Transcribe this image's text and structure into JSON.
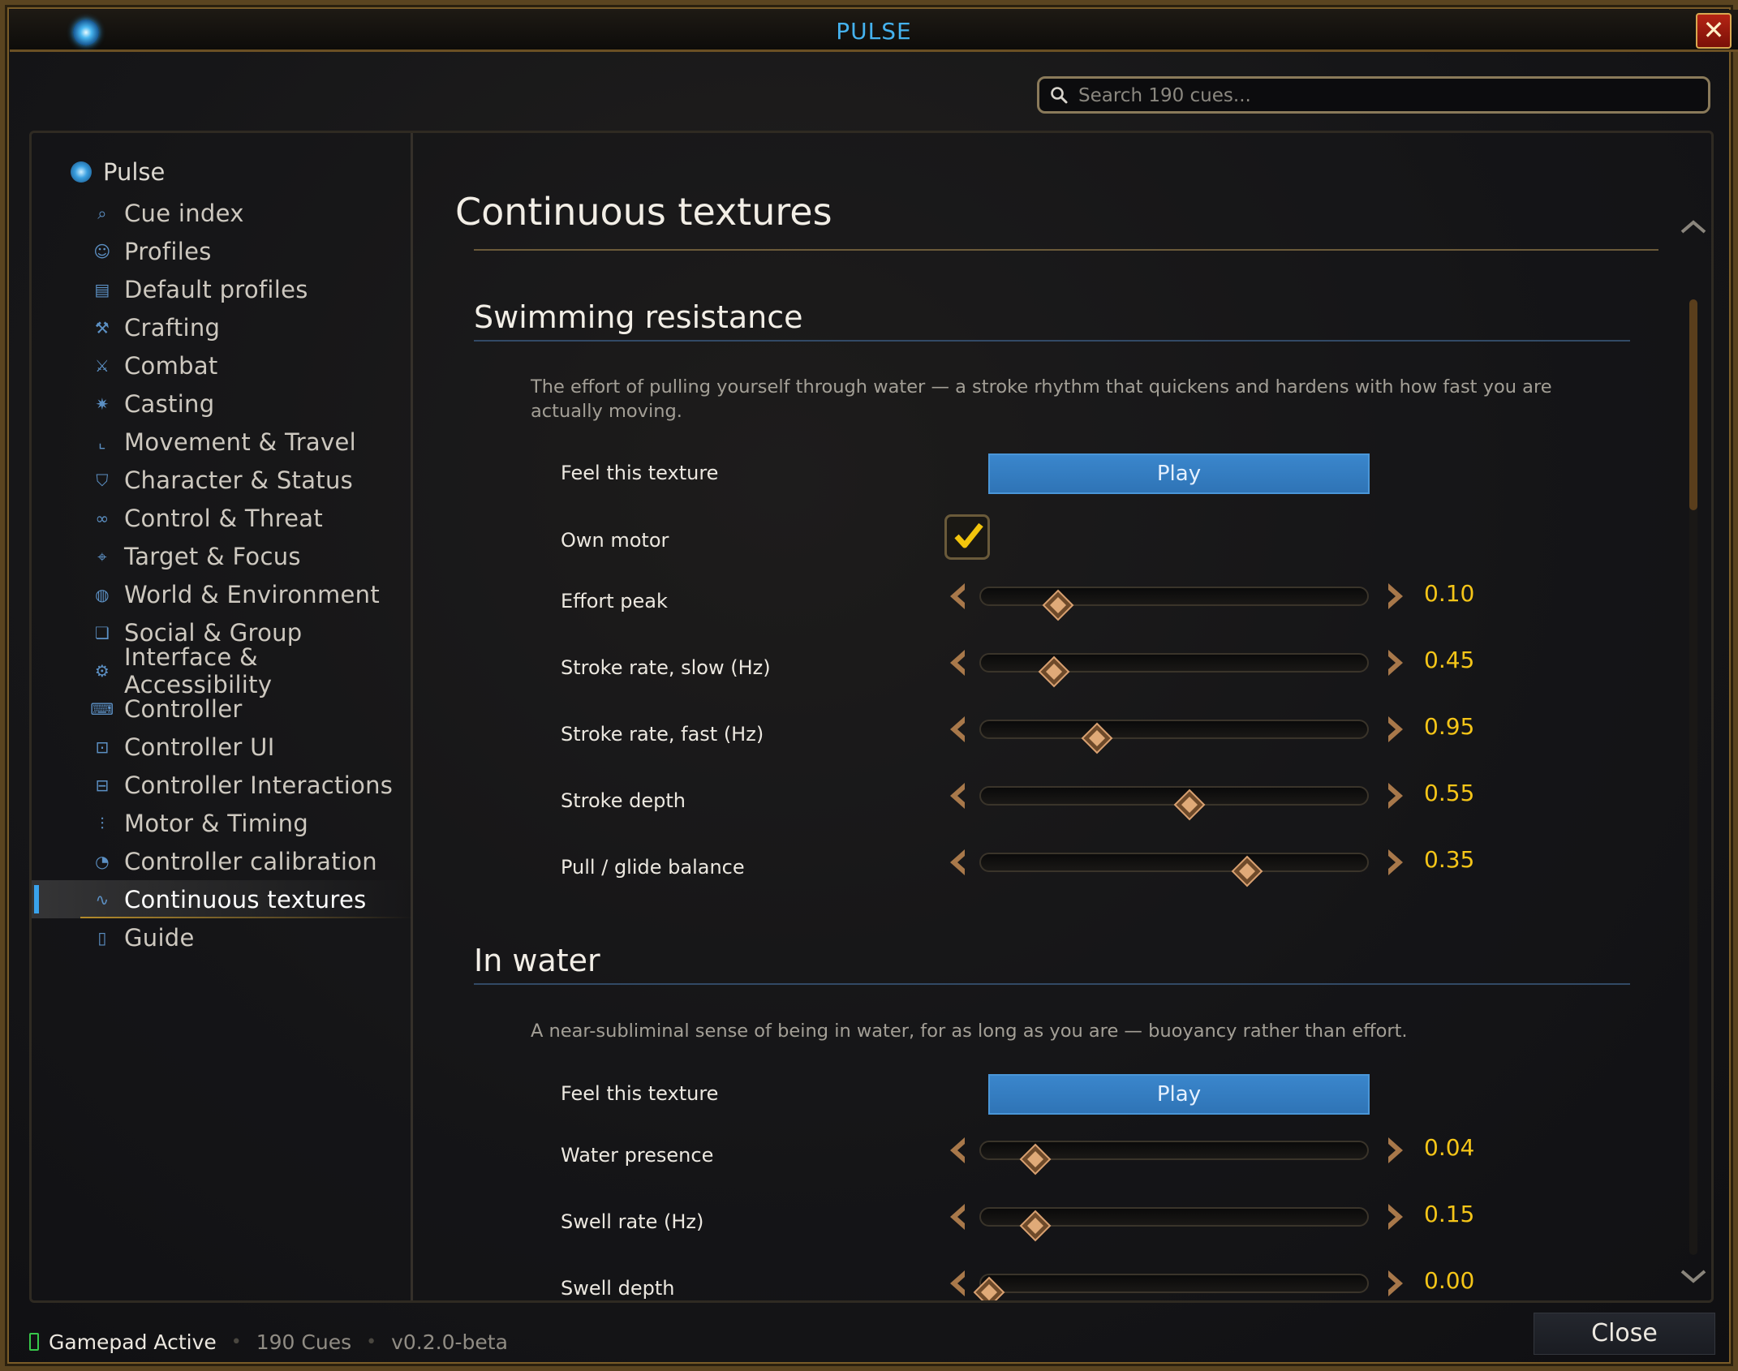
{
  "window": {
    "title": "PULSE",
    "close_glyph": "✕"
  },
  "search": {
    "placeholder": "Search 190 cues..."
  },
  "sidebar": {
    "root_label": "Pulse",
    "items": [
      {
        "label": "Cue index",
        "icon": "magnifier-icon",
        "glyph": "⌕"
      },
      {
        "label": "Profiles",
        "icon": "person-icon",
        "glyph": "☺"
      },
      {
        "label": "Default profiles",
        "icon": "document-icon",
        "glyph": "▤"
      },
      {
        "label": "Crafting",
        "icon": "anvil-icon",
        "glyph": "⚒"
      },
      {
        "label": "Combat",
        "icon": "crossed-swords-icon",
        "glyph": "⚔"
      },
      {
        "label": "Casting",
        "icon": "sparkle-icon",
        "glyph": "✷"
      },
      {
        "label": "Movement & Travel",
        "icon": "boot-icon",
        "glyph": "⌞"
      },
      {
        "label": "Character & Status",
        "icon": "shield-icon",
        "glyph": "⛉"
      },
      {
        "label": "Control & Threat",
        "icon": "chain-icon",
        "glyph": "∞"
      },
      {
        "label": "Target & Focus",
        "icon": "crosshair-icon",
        "glyph": "⌖"
      },
      {
        "label": "World & Environment",
        "icon": "globe-icon",
        "glyph": "◍"
      },
      {
        "label": "Social & Group",
        "icon": "chat-icon",
        "glyph": "❏"
      },
      {
        "label": "Interface & Accessibility",
        "icon": "gear-icon",
        "glyph": "⚙"
      },
      {
        "label": "Controller",
        "icon": "gamepad-icon",
        "glyph": "⌨"
      },
      {
        "label": "Controller UI",
        "icon": "controller-ui-icon",
        "glyph": "⊡"
      },
      {
        "label": "Controller Interactions",
        "icon": "controller-interactions-icon",
        "glyph": "⊟"
      },
      {
        "label": "Motor & Timing",
        "icon": "equalizer-icon",
        "glyph": "⫶"
      },
      {
        "label": "Controller calibration",
        "icon": "gauge-icon",
        "glyph": "◔"
      },
      {
        "label": "Continuous textures",
        "icon": "wave-icon",
        "glyph": "∿"
      },
      {
        "label": "Guide",
        "icon": "book-icon",
        "glyph": "▯"
      }
    ],
    "active_index": 18
  },
  "main": {
    "title": "Continuous textures",
    "sections": [
      {
        "title": "Swimming resistance",
        "description": "The effort of pulling yourself through water — a stroke rhythm that quickens and hardens with how fast you are actually moving.",
        "feel_label": "Feel this texture",
        "play_label": "Play",
        "own_motor": {
          "label": "Own motor",
          "checked": true
        },
        "sliders": [
          {
            "label": "Effort peak",
            "value": "0.10",
            "position": 0.2
          },
          {
            "label": "Stroke rate, slow (Hz)",
            "value": "0.45",
            "position": 0.19
          },
          {
            "label": "Stroke rate, fast (Hz)",
            "value": "0.95",
            "position": 0.3
          },
          {
            "label": "Stroke depth",
            "value": "0.55",
            "position": 0.54
          },
          {
            "label": "Pull / glide balance",
            "value": "0.35",
            "position": 0.69
          }
        ]
      },
      {
        "title": "In water",
        "description": "A near-subliminal sense of being in water, for as long as you are — buoyancy rather than effort.",
        "feel_label": "Feel this texture",
        "play_label": "Play",
        "sliders": [
          {
            "label": "Water presence",
            "value": "0.04",
            "position": 0.14
          },
          {
            "label": "Swell rate (Hz)",
            "value": "0.15",
            "position": 0.14
          },
          {
            "label": "Swell depth",
            "value": "0.00",
            "position": 0.02
          }
        ]
      }
    ]
  },
  "status": {
    "gamepad": "Gamepad Active",
    "separator": "•",
    "cues": "190 Cues",
    "version": "v0.2.0-beta"
  },
  "footer": {
    "close_label": "Close"
  },
  "colors": {
    "accent": "#39a3ec",
    "value": "#f5c518",
    "gold": "#b38a2a",
    "play": "#3a86cc"
  }
}
